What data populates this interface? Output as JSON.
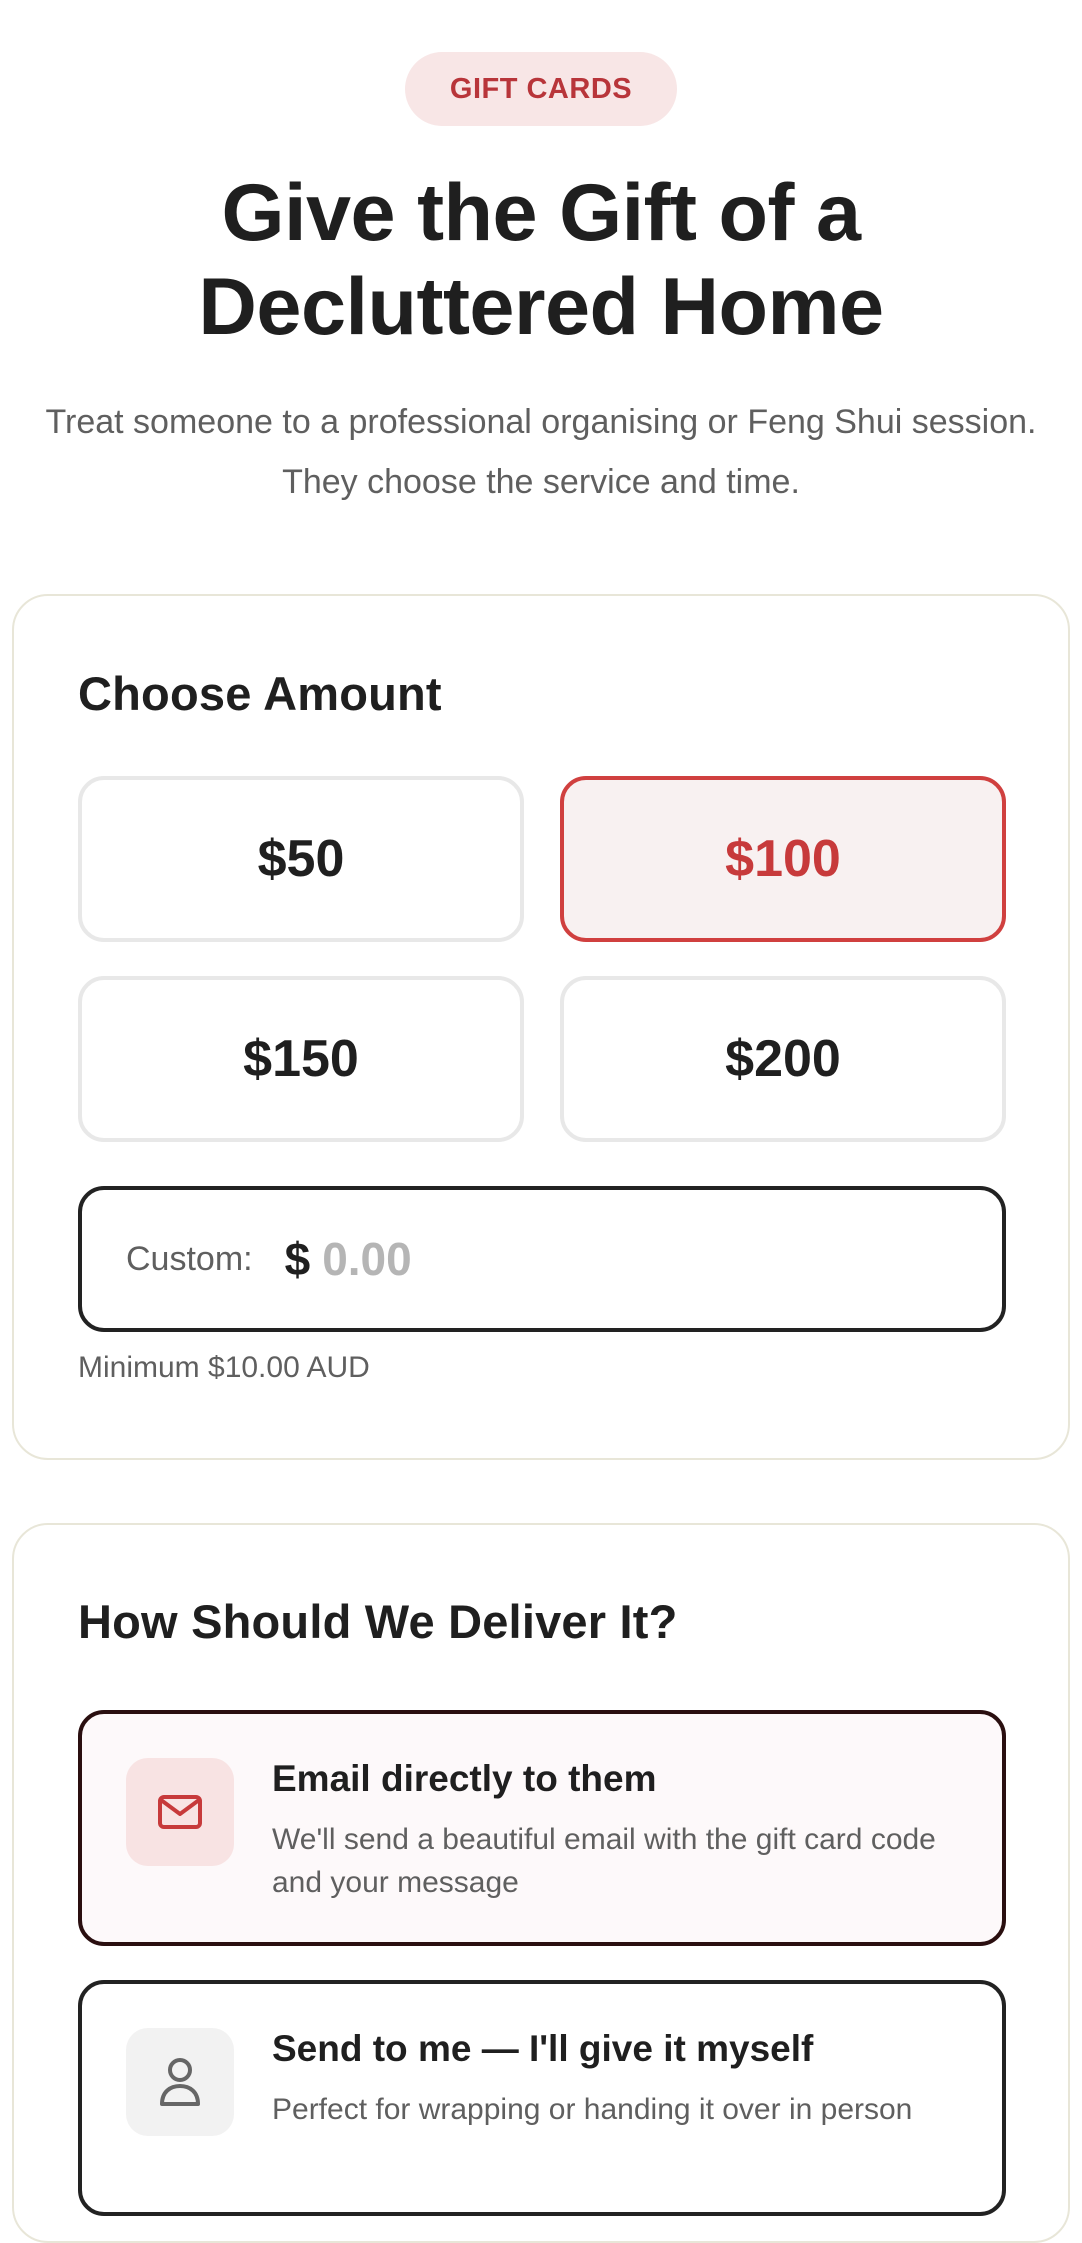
{
  "header": {
    "badge": "GIFT CARDS",
    "title": "Give the Gift of a Decluttered Home",
    "subtitle": "Treat someone to a professional organising or Feng Shui session. They choose the service and time."
  },
  "amount": {
    "title": "Choose Amount",
    "options": [
      {
        "label": "$50",
        "selected": false
      },
      {
        "label": "$100",
        "selected": true
      },
      {
        "label": "$150",
        "selected": false
      },
      {
        "label": "$200",
        "selected": false
      }
    ],
    "custom_label": "Custom:",
    "currency": "$",
    "custom_placeholder": "0.00",
    "custom_value": "",
    "minimum_hint": "Minimum $10.00 AUD"
  },
  "delivery": {
    "title": "How Should We Deliver It?",
    "options": [
      {
        "icon": "mail-icon",
        "title": "Email directly to them",
        "description": "We'll send a beautiful email with the gift card code and your message",
        "selected": true
      },
      {
        "icon": "user-icon",
        "title": "Send to me — I'll give it myself",
        "description": "Perfect for wrapping or handing it over in person",
        "selected": false
      }
    ]
  },
  "colors": {
    "accent": "#c73a3b",
    "accent_soft": "#f8e6e6",
    "card_border": "#e8e6d8",
    "text_dark": "#1f1f1f",
    "text_muted": "#5f5f5f"
  }
}
